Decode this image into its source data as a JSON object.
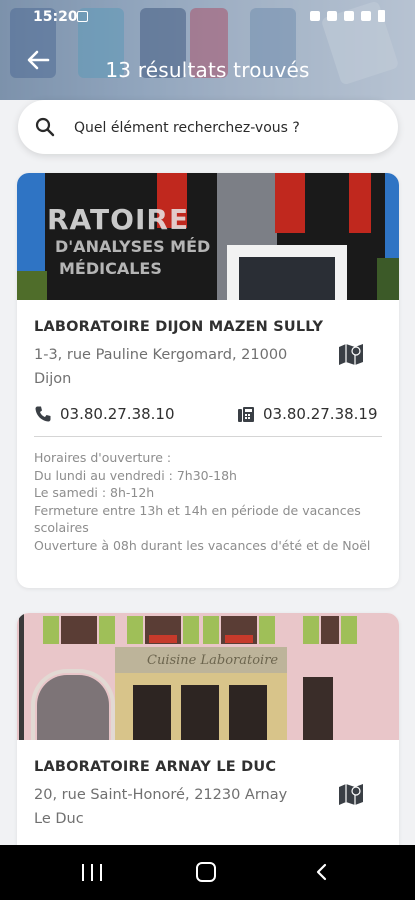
{
  "status_bar": {
    "time": "15:20"
  },
  "header": {
    "title": "13 résultats trouvés"
  },
  "search": {
    "placeholder": "Quel élément recherchez-vous ?"
  },
  "results": [
    {
      "name": "LABORATOIRE DIJON MAZEN SULLY",
      "address": "1-3, rue Pauline Kergomard, 21000 Dijon",
      "phone": "03.80.27.38.10",
      "fax": "03.80.27.38.19",
      "hours": [
        "Horaires d'ouverture :",
        "Du lundi au vendredi : 7h30-18h",
        "Le samedi : 8h-12h",
        "Fermeture entre 13h et 14h en période de vacances scolaires",
        "Ouverture à 08h durant les vacances d'été et de Noël"
      ],
      "photo_text": [
        "RATOIRE",
        "D'ANALYSES MÉD",
        "MÉDICALES"
      ]
    },
    {
      "name": "LABORATOIRE ARNAY LE DUC",
      "address": "20, rue Saint-Honoré, 21230  Arnay Le Duc",
      "photo_text": [
        "Cuisine Laboratoire"
      ]
    }
  ],
  "icons": {
    "back": "arrow-left-icon",
    "search": "search-icon",
    "map": "map-icon",
    "phone": "phone-icon",
    "fax": "fax-icon"
  },
  "colors": {
    "background": "#f1f2f4",
    "name_text": "#303030",
    "address_text": "#707070",
    "hours_text": "#8d8d8d"
  }
}
